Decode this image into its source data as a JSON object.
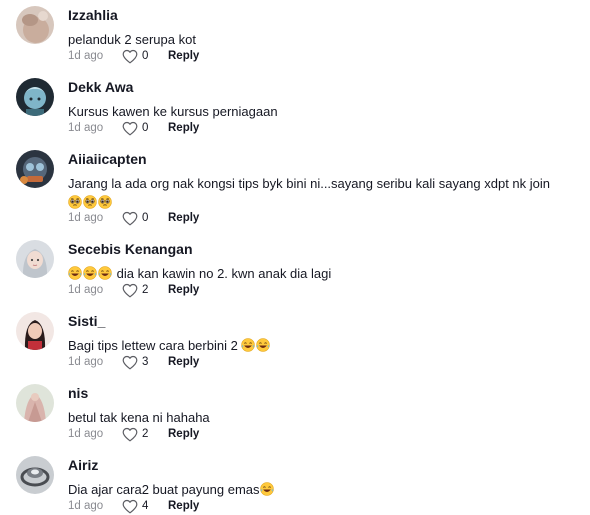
{
  "comments": [
    {
      "username": "Izzahlia",
      "text": "pelanduk 2 serupa kot",
      "time": "1d ago",
      "likes": "0",
      "reply": "Reply"
    },
    {
      "username": "Dekk Awa",
      "text": "Kursus kawen ke kursus perniagaan",
      "time": "1d ago",
      "likes": "0",
      "reply": "Reply"
    },
    {
      "username": "Aiiaiicapten",
      "text": "Jarang la ada org nak kongsi tips byk bini ni...sayang seribu kali sayang xdpt nk join",
      "emoji_line": "🥺🥺🥺",
      "time": "1d ago",
      "likes": "0",
      "reply": "Reply"
    },
    {
      "username": "Secebis Kenangan",
      "emoji_prefix": "😂😂😂",
      "text": "dia kan kawin no 2. kwn anak dia lagi",
      "time": "1d ago",
      "likes": "2",
      "reply": "Reply"
    },
    {
      "username": "Sisti_",
      "text": "Bagi tips lettew cara berbini 2",
      "emoji_suffix": "😂😂",
      "time": "1d ago",
      "likes": "3",
      "reply": "Reply"
    },
    {
      "username": "nis",
      "text": "betul tak kena ni hahaha",
      "time": "1d ago",
      "likes": "2",
      "reply": "Reply"
    },
    {
      "username": "Airiz",
      "text": "Dia ajar cara2 buat payung emas",
      "emoji_suffix": "😂",
      "time": "1d ago",
      "likes": "4",
      "reply": "Reply"
    }
  ],
  "icons": {
    "like": "heart-outline-icon",
    "laugh_emoji": "face-with-tears-of-joy-icon",
    "pleading_emoji": "pleading-face-icon"
  },
  "colors": {
    "text_primary": "#161823",
    "text_secondary": "#8a8b91",
    "background": "#ffffff"
  }
}
